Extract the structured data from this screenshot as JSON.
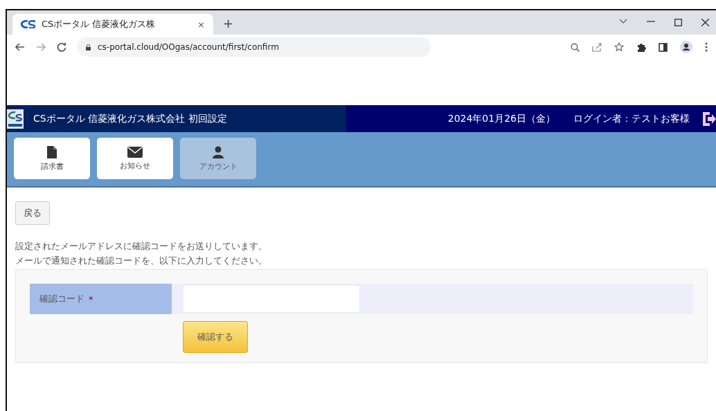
{
  "browser": {
    "tab_title": "CSポータル 信菱液化ガス株",
    "tab_close": "×",
    "new_tab": "+",
    "url": "cs-portal.cloud/OOgas/account/first/confirm"
  },
  "header": {
    "title": "CSポータル 信菱液化ガス株式会社 初回設定",
    "date": "2024年01月26日（金）",
    "user": "ログイン者：テストお客様"
  },
  "nav": [
    {
      "label": "請求書",
      "kind": "document",
      "selected": false
    },
    {
      "label": "お知らせ",
      "kind": "mail",
      "selected": false
    },
    {
      "label": "アカウント",
      "kind": "person",
      "selected": true
    }
  ],
  "back_button": "戻る",
  "message": [
    "設定されたメールアドレスに確認コードをお送りしています。",
    "メールで通知された確認コードを、以下に入力してください。"
  ],
  "form": {
    "label": "確認コード",
    "required_mark": "*",
    "submit": "確認する"
  }
}
